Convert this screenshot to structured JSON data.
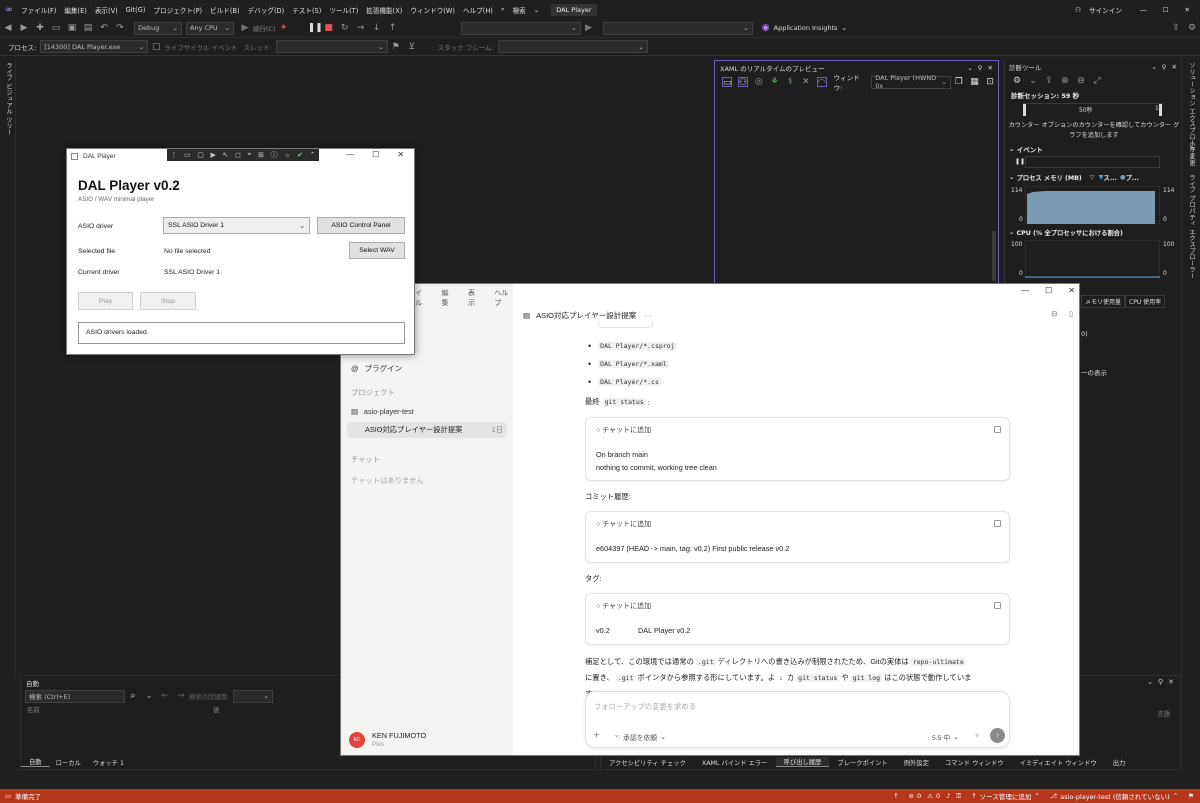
{
  "menubar": {
    "items": [
      "ファイル(F)",
      "編集(E)",
      "表示(V)",
      "Git(G)",
      "プロジェクト(P)",
      "ビルド(B)",
      "デバッグ(D)",
      "テスト(S)",
      "ツール(T)",
      "拡張機能(X)",
      "ウィンドウ(W)",
      "ヘルプ(H)"
    ],
    "search": "検索",
    "title": "DAL Player",
    "signin": "サインイン"
  },
  "toolbar": {
    "config": "Debug",
    "platform": "Any CPU",
    "continue": "続行(C)",
    "app_insights": "Application Insights"
  },
  "debugbar": {
    "process_label": "プロセス:",
    "process": "[14300] DAL Player.exe",
    "lifecycle": "ライフサイクル イベント",
    "thread_label": "スレッド:",
    "stackframe_label": "スタック フレーム:"
  },
  "left_strip": {
    "label": "ライブ ビジュアル ツリー"
  },
  "right_strip": {
    "labels": [
      "ソリューション エクスプローラー",
      "Git 変更",
      "ライブ プロパティ エクスプローラー"
    ]
  },
  "xaml_panel": {
    "title": "XAML のリアルタイムのプレビュー",
    "window_label": "ウィンドウ:",
    "window_value": "DAL Player (HWND 0x"
  },
  "diag_panel": {
    "title": "診断ツール",
    "session": "診断セッション: 59 秒",
    "tick_50": "50秒",
    "tick_1": "1",
    "counter_hint": "カウンター オプションのカウンターを確認してカウンター グラフを追加します",
    "events": "イベント",
    "process_memory": "プロセス メモリ (MB)",
    "legend_s": "ス...",
    "legend_p": "プ...",
    "mem_max": "114",
    "mem_min": "0",
    "cpu": "CPU (% 全プロセッサにおける割合)",
    "cpu_max": "100",
    "cpu_min": "0",
    "tab_mem": "メモリ使用量",
    "tab_cpu": "CPU 使用率",
    "frag1": "0)",
    "frag2": "一の表示"
  },
  "dal": {
    "window_title": "DAL Player",
    "heading": "DAL Player v0.2",
    "subtitle": "ASIO / WAV minimal player",
    "asio_driver_label": "ASIO driver",
    "asio_driver_value": "SSL ASIO Driver 1",
    "control_panel": "ASIO Control Panel",
    "selected_file_label": "Selected file",
    "selected_file_value": "No file selected",
    "select_wav": "Select WAV",
    "current_driver_label": "Current driver",
    "current_driver_value": "SSL ASIO Driver 1",
    "play": "Play",
    "stop": "Stop",
    "status": "ASIO drivers loaded."
  },
  "chat": {
    "menu": [
      "イル",
      "編集",
      "表示",
      "ヘルプ"
    ],
    "plugins": "プラグイン",
    "projects_heading": "プロジェクト",
    "project": "asio-player-test",
    "thread": "ASIO対応プレイヤー設計提案",
    "thread_age": "1日",
    "chats_heading": "チャット",
    "no_chats": "チャットはありません",
    "user_name": "KEN FUJIMOTO",
    "user_plan": "Plus",
    "user_initials": "KF",
    "header_title": "ASIO対応プレイヤー設計提案",
    "bullets": [
      "DAL Player/*.csproj",
      "DAL Player/*.xaml",
      "DAL Player/*.cs"
    ],
    "final_label": "最終",
    "final_code": "git status",
    "final_colon": ":",
    "add_to_chat": "チャットに追加",
    "git_status_out_1": "On branch main",
    "git_status_out_2": "nothing to commit, working tree clean",
    "commit_label": "コミット履歴:",
    "commit_out": "e604397 (HEAD -> main, tag: v0.2) First public release v0.2",
    "tag_label": "タグ:",
    "tag_name": "v0.2",
    "tag_msg": "DAL Player v0.2",
    "note_1a": "補足として、この環境では通常の",
    "note_code_git": ".git",
    "note_1b": "ディレクトリへの書き込みが制限されたため、Gitの実体は",
    "note_code_repo": "repo-ultimate",
    "note_2a": "に置き、",
    "note_2b": "ポインタから参照する形にしています。よ",
    "note_2c": "カ",
    "note_code_status": "git status",
    "note_2d": "や",
    "note_code_log": "git log",
    "note_2e": "はこの状態で動作していま",
    "note_3": "す。",
    "input_placeholder": "フォローアップの変更を求める",
    "approval": "承認を依頼",
    "model": "5.5 中"
  },
  "auto_panel": {
    "title": "自動",
    "search": "検索 (Ctrl+E)",
    "depth_label": "検索の詳細度:",
    "col_name": "名前",
    "col_value": "値",
    "tabs": [
      "自動",
      "ローカル",
      "ウォッチ 1"
    ]
  },
  "right_bottom": {
    "col_lang": "言語",
    "tabs": [
      "アクセシビリティ チェック",
      "XAML バインド エラー",
      "呼び出し履歴",
      "ブレークポイント",
      "例外設定",
      "コマンド ウィンドウ",
      "イミディエイト ウィンドウ",
      "出力"
    ]
  },
  "statusbar": {
    "ready": "準備完了",
    "errors": "0",
    "warnings": "0",
    "src_control": "ソース管理に追加",
    "repo": "asio-player-test (信頼されていない)"
  },
  "colors": {
    "accent": "#6a5fb8",
    "status": "#b5361c",
    "memory_fill": "#7a9bb4"
  }
}
